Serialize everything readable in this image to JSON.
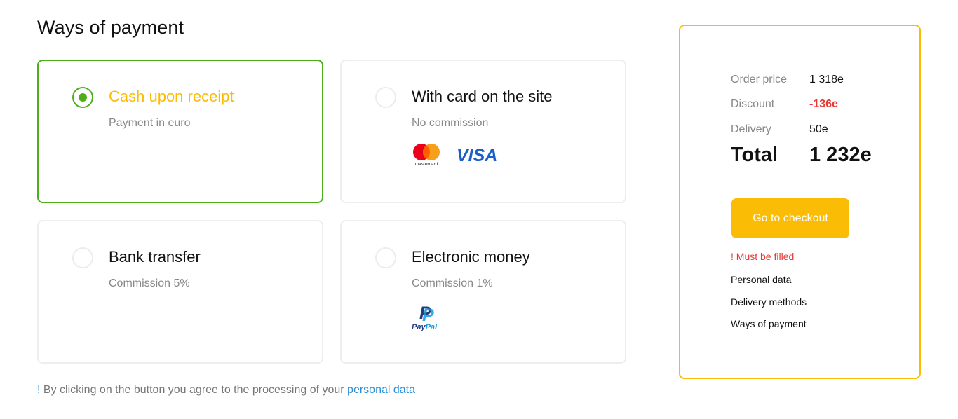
{
  "page": {
    "title": "Ways of payment"
  },
  "payment_methods": [
    {
      "title": "Cash upon receipt",
      "subtitle": "Payment in euro",
      "selected": true
    },
    {
      "title": "With card on the site",
      "subtitle": "No commission",
      "selected": false,
      "logos": [
        "mastercard-logo",
        "visa-logo"
      ],
      "logo_text": {
        "mastercard": "mastercard",
        "visa": "VISA"
      }
    },
    {
      "title": "Bank transfer",
      "subtitle": "Commission 5%",
      "selected": false
    },
    {
      "title": "Electronic money",
      "subtitle": "Commission 1%",
      "selected": false,
      "logos": [
        "paypal-logo"
      ],
      "logo_text": {
        "paypal": "PayPal"
      }
    }
  ],
  "agreement": {
    "prefix": "!",
    "text": " By clicking on the button you agree to the processing of your ",
    "link": "personal data"
  },
  "summary": {
    "order_price_label": "Order price",
    "order_price": "1 318e",
    "discount_label": "Discount",
    "discount": "-136e",
    "delivery_label": "Delivery",
    "delivery": "50e",
    "total_label": "Total",
    "total": "1 232e",
    "checkout_label": "Go to checkout",
    "must_be_filled": "! Must be filled",
    "required_fields": [
      "Personal data",
      "Delivery methods",
      "Ways of payment"
    ]
  },
  "colors": {
    "accent": "#fbbc05",
    "selected": "#4caf1a",
    "error": "#e53935",
    "link": "#2d8ed6",
    "visa": "#1a5fc8",
    "paypal_dark": "#253b80",
    "paypal_light": "#179bd7"
  }
}
